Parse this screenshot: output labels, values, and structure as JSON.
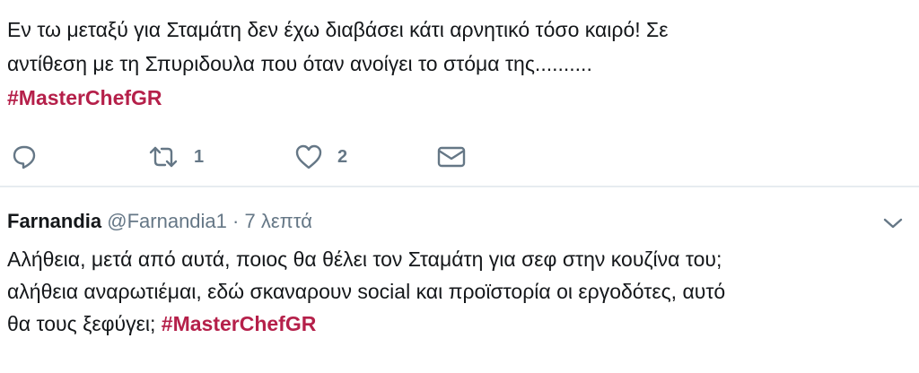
{
  "tweet_top": {
    "text_line1": "Εν τω μεταξύ για Σταμάτη δεν έχω διαβάσει κάτι αρνητικό τόσο καιρό! Σε",
    "text_line2": "αντίθεση με τη Σπυριδουλα που όταν ανοίγει το στόμα της..........",
    "hashtag": "#MasterChefGR",
    "actions": {
      "reply_icon": "reply-icon",
      "retweet_icon": "retweet-icon",
      "retweet_count": "1",
      "like_icon": "heart-icon",
      "like_count": "2",
      "dm_icon": "envelope-icon"
    }
  },
  "tweet_bottom": {
    "name": "Farnandia",
    "handle": "@Farnandia1",
    "separator": "·",
    "time": "7 λεπτά",
    "menu_icon": "chevron-down-icon",
    "text_line1": "Αλήθεια, μετά από αυτά, ποιος θα θέλει τον Σταμάτη για σεφ στην κουζίνα του;",
    "text_line2": "αλήθεια αναρωτιέμαι, εδώ σκαναρουν social και προϊστορία οι εργοδότες, αυτό",
    "text_line3": "θα τους ξεφύγει;",
    "hashtag": "#MasterChefGR"
  },
  "colors": {
    "hashtag": "#b5204a",
    "muted": "#657786",
    "text": "#14171a",
    "divider": "#e6ecf0"
  }
}
